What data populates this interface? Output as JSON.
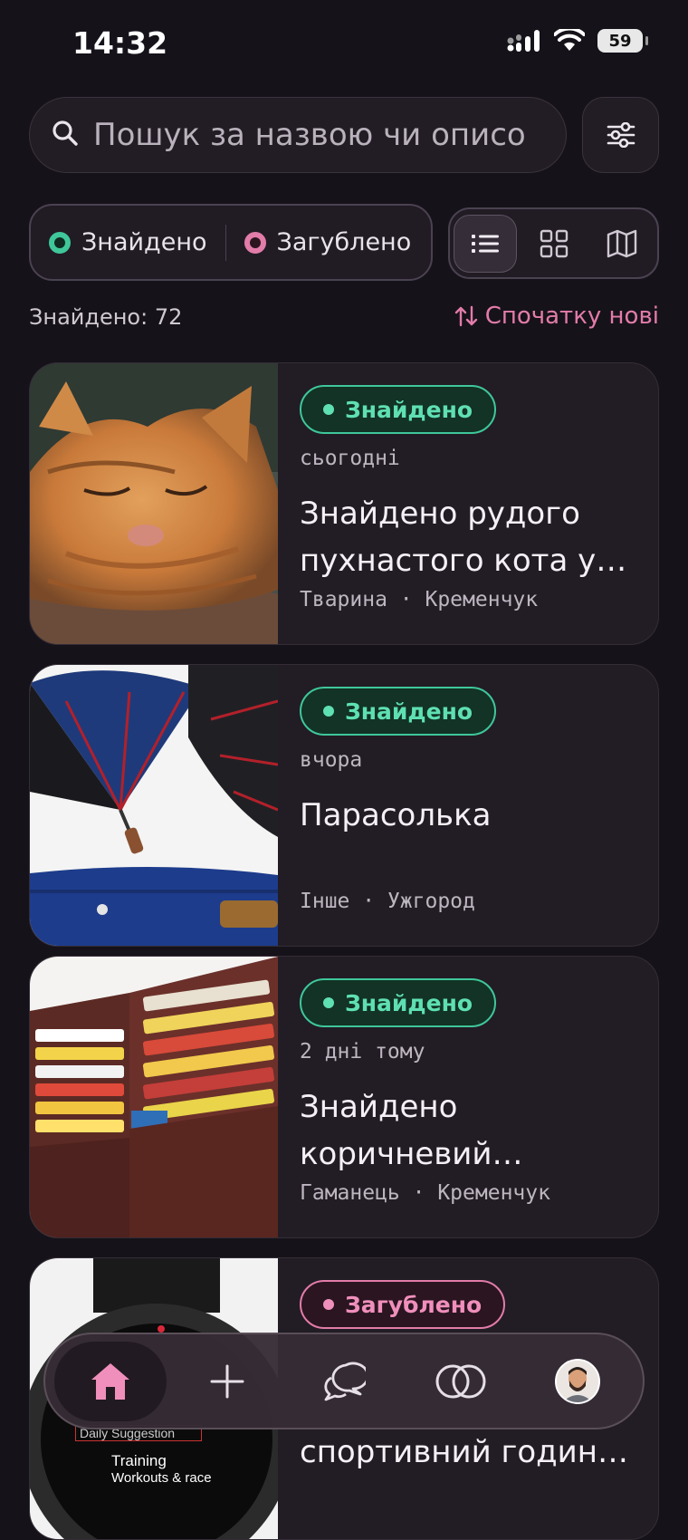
{
  "status_bar": {
    "time": "14:32",
    "battery": "59"
  },
  "search": {
    "placeholder": "Пошук за назвою чи описом"
  },
  "status_filter": {
    "found_label": "Знайдено",
    "lost_label": "Загублено"
  },
  "results": {
    "count_label": "Знайдено: 72",
    "sort_label": "Спочатку нові"
  },
  "items": [
    {
      "status": "Знайдено",
      "date": "сьогодні",
      "title": "Знайдено рудого пухнастого кота у…",
      "category": "Тварина",
      "city": "Кременчук"
    },
    {
      "status": "Знайдено",
      "date": "вчора",
      "title": "Парасолька",
      "category": "Інше",
      "city": "Ужгород"
    },
    {
      "status": "Знайдено",
      "date": "2 дні тому",
      "title": "Знайдено коричневий шкірян…",
      "category": "Гаманець",
      "city": "Кременчук"
    },
    {
      "status": "Загублено",
      "date": "",
      "title": "спортивний годин…",
      "category": "",
      "city": ""
    }
  ],
  "watch_text": {
    "line1": "Training",
    "line2": "Workouts & race",
    "line3": "Daily Suggestion"
  },
  "colors": {
    "background": "#16121a",
    "found": "#3fc79a",
    "lost": "#e27ca9",
    "card": "#221c25"
  }
}
